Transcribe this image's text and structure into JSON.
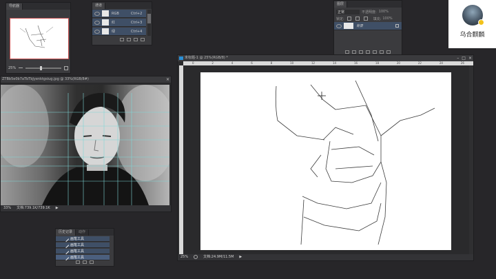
{
  "navigator": {
    "tab": "导航器",
    "zoom": "25%"
  },
  "channels": {
    "tab": "通道",
    "rows": [
      {
        "name": "RGB",
        "shortcut": "Ctrl+2"
      },
      {
        "name": "红",
        "shortcut": "Ctrl+3"
      },
      {
        "name": "绿",
        "shortcut": "Ctrl+4"
      }
    ]
  },
  "layers": {
    "tab": "图层",
    "mode": "正常",
    "opacity_label": "不透明度:",
    "opacity": "100%",
    "lock_label": "锁定:",
    "fill_label": "填充:",
    "fill": "100%",
    "layer_name": "背景"
  },
  "photo_window": {
    "title": "ZTBb5e0b7aTbTbJyenktgsiug.jpg @ 33%(RGB/8#)",
    "status_zoom": "33%",
    "status_doc": "文档:739.1K/739.1K"
  },
  "sketch_window": {
    "title": "未标题-1 @ 25%(RGB/8) *",
    "status_zoom": "25%",
    "status_doc": "文档:24.9M/11.5M",
    "ruler_numbers": [
      "0",
      "2",
      "4",
      "6",
      "8",
      "10",
      "12",
      "14",
      "16",
      "18",
      "20",
      "22",
      "24",
      "26"
    ]
  },
  "history": {
    "tabs": [
      "历史记录",
      "动作"
    ],
    "rows": [
      "画笔工具",
      "画笔工具",
      "画笔工具",
      "画笔工具"
    ]
  },
  "watermark": {
    "name": "乌合麒麟"
  },
  "colors": {
    "workspace": "#272629",
    "panel": "#3b3b3e",
    "selection": "#3f4f66",
    "canvas": "#ffffff",
    "guide": "#7fd7d7"
  }
}
